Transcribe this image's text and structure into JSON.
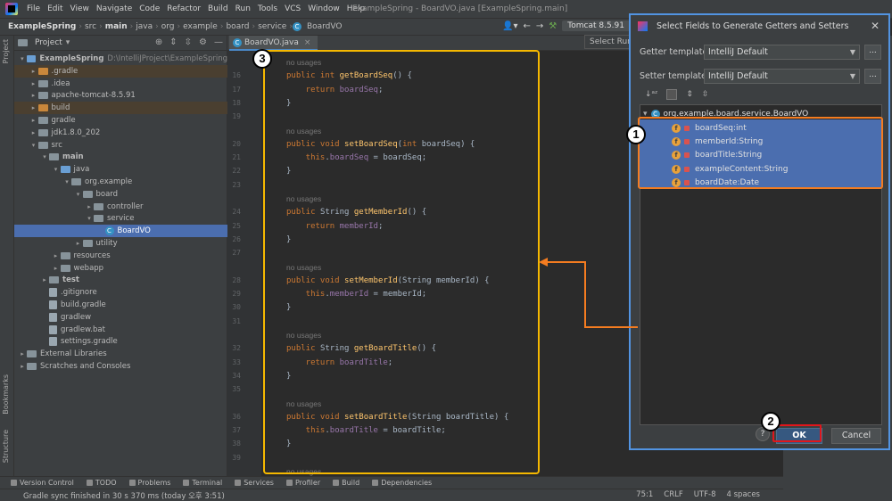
{
  "menu": [
    "File",
    "Edit",
    "View",
    "Navigate",
    "Code",
    "Refactor",
    "Build",
    "Run",
    "Tools",
    "VCS",
    "Window",
    "Help"
  ],
  "window_title": "ExampleSpring - BoardVO.java [ExampleSpring.main]",
  "breadcrumbs": [
    "ExampleSpring",
    "src",
    "main",
    "java",
    "org",
    "example",
    "board",
    "service",
    "BoardVO"
  ],
  "run_config": "Tomcat 8.5.91",
  "run_tooltip": "Select Run/",
  "left_tabs": [
    "Project",
    "Bookmarks",
    "Structure"
  ],
  "project_panel": {
    "title": "Project",
    "tree": [
      {
        "label": "ExampleSpring",
        "hint": "D:\\IntelliJProject\\ExampleSpring",
        "indent": 0,
        "open": true,
        "icon": "folder-blue",
        "bold": true
      },
      {
        "label": ".gradle",
        "indent": 1,
        "open": false,
        "icon": "folder-orange",
        "hl": true
      },
      {
        "label": ".idea",
        "indent": 1,
        "open": false,
        "icon": "folder"
      },
      {
        "label": "apache-tomcat-8.5.91",
        "indent": 1,
        "open": false,
        "icon": "folder"
      },
      {
        "label": "build",
        "indent": 1,
        "open": false,
        "icon": "folder-orange",
        "hl": true
      },
      {
        "label": "gradle",
        "indent": 1,
        "open": false,
        "icon": "folder"
      },
      {
        "label": "jdk1.8.0_202",
        "indent": 1,
        "open": false,
        "icon": "folder"
      },
      {
        "label": "src",
        "indent": 1,
        "open": true,
        "icon": "folder"
      },
      {
        "label": "main",
        "indent": 2,
        "open": true,
        "icon": "folder",
        "bold": true
      },
      {
        "label": "java",
        "indent": 3,
        "open": true,
        "icon": "folder-blue"
      },
      {
        "label": "org.example",
        "indent": 4,
        "open": true,
        "icon": "folder"
      },
      {
        "label": "board",
        "indent": 5,
        "open": true,
        "icon": "folder"
      },
      {
        "label": "controller",
        "indent": 6,
        "open": false,
        "icon": "folder"
      },
      {
        "label": "service",
        "indent": 6,
        "open": true,
        "icon": "folder"
      },
      {
        "label": "BoardVO",
        "indent": 7,
        "leaf": true,
        "icon": "class",
        "sel": true
      },
      {
        "label": "utility",
        "indent": 5,
        "open": false,
        "icon": "folder"
      },
      {
        "label": "resources",
        "indent": 3,
        "open": false,
        "icon": "folder"
      },
      {
        "label": "webapp",
        "indent": 3,
        "open": false,
        "icon": "folder"
      },
      {
        "label": "test",
        "indent": 2,
        "open": false,
        "icon": "folder",
        "bold": true
      },
      {
        "label": ".gitignore",
        "indent": 2,
        "leaf": true,
        "icon": "file"
      },
      {
        "label": "build.gradle",
        "indent": 2,
        "leaf": true,
        "icon": "file"
      },
      {
        "label": "gradlew",
        "indent": 2,
        "leaf": true,
        "icon": "file"
      },
      {
        "label": "gradlew.bat",
        "indent": 2,
        "leaf": true,
        "icon": "file"
      },
      {
        "label": "settings.gradle",
        "indent": 2,
        "leaf": true,
        "icon": "file"
      },
      {
        "label": "External Libraries",
        "indent": 0,
        "open": false,
        "icon": "folder"
      },
      {
        "label": "Scratches and Consoles",
        "indent": 0,
        "open": false,
        "icon": "folder"
      }
    ]
  },
  "editor": {
    "tab_label": "BoardVO.java",
    "lines": [
      {
        "n": "",
        "kind": "usages",
        "text": "no usages"
      },
      {
        "n": "16",
        "kind": "code",
        "parts": [
          [
            "kw",
            "public int "
          ],
          [
            "fn",
            "getBoardSeq"
          ],
          [
            "pl",
            "() {"
          ]
        ]
      },
      {
        "n": "17",
        "kind": "code",
        "parts": [
          [
            "kw",
            "    return "
          ],
          [
            "fld",
            "boardSeq"
          ],
          [
            "pl",
            ";"
          ]
        ]
      },
      {
        "n": "18",
        "kind": "code",
        "parts": [
          [
            "pl",
            "}"
          ]
        ]
      },
      {
        "n": "19",
        "kind": "code",
        "parts": []
      },
      {
        "n": "",
        "kind": "usages",
        "text": "no usages"
      },
      {
        "n": "20",
        "kind": "code",
        "parts": [
          [
            "kw",
            "public void "
          ],
          [
            "fn",
            "setBoardSeq"
          ],
          [
            "pl",
            "("
          ],
          [
            "kw",
            "int "
          ],
          [
            "pl",
            "boardSeq) {"
          ]
        ]
      },
      {
        "n": "21",
        "kind": "code",
        "parts": [
          [
            "kw",
            "    this"
          ],
          [
            "pl",
            "."
          ],
          [
            "fld",
            "boardSeq"
          ],
          [
            "pl",
            " = boardSeq;"
          ]
        ]
      },
      {
        "n": "22",
        "kind": "code",
        "parts": [
          [
            "pl",
            "}"
          ]
        ]
      },
      {
        "n": "23",
        "kind": "code",
        "parts": []
      },
      {
        "n": "",
        "kind": "usages",
        "text": "no usages"
      },
      {
        "n": "24",
        "kind": "code",
        "parts": [
          [
            "kw",
            "public "
          ],
          [
            "pl",
            "String "
          ],
          [
            "fn",
            "getMemberId"
          ],
          [
            "pl",
            "() {"
          ]
        ]
      },
      {
        "n": "25",
        "kind": "code",
        "parts": [
          [
            "kw",
            "    return "
          ],
          [
            "fld",
            "memberId"
          ],
          [
            "pl",
            ";"
          ]
        ]
      },
      {
        "n": "26",
        "kind": "code",
        "parts": [
          [
            "pl",
            "}"
          ]
        ]
      },
      {
        "n": "27",
        "kind": "code",
        "parts": []
      },
      {
        "n": "",
        "kind": "usages",
        "text": "no usages"
      },
      {
        "n": "28",
        "kind": "code",
        "parts": [
          [
            "kw",
            "public void "
          ],
          [
            "fn",
            "setMemberId"
          ],
          [
            "pl",
            "(String memberId) {"
          ]
        ]
      },
      {
        "n": "29",
        "kind": "code",
        "parts": [
          [
            "kw",
            "    this"
          ],
          [
            "pl",
            "."
          ],
          [
            "fld",
            "memberId"
          ],
          [
            "pl",
            " = memberId;"
          ]
        ]
      },
      {
        "n": "30",
        "kind": "code",
        "parts": [
          [
            "pl",
            "}"
          ]
        ]
      },
      {
        "n": "31",
        "kind": "code",
        "parts": []
      },
      {
        "n": "",
        "kind": "usages",
        "text": "no usages"
      },
      {
        "n": "32",
        "kind": "code",
        "parts": [
          [
            "kw",
            "public "
          ],
          [
            "pl",
            "String "
          ],
          [
            "fn",
            "getBoardTitle"
          ],
          [
            "pl",
            "() {"
          ]
        ]
      },
      {
        "n": "33",
        "kind": "code",
        "parts": [
          [
            "kw",
            "    return "
          ],
          [
            "fld",
            "boardTitle"
          ],
          [
            "pl",
            ";"
          ]
        ]
      },
      {
        "n": "34",
        "kind": "code",
        "parts": [
          [
            "pl",
            "}"
          ]
        ]
      },
      {
        "n": "35",
        "kind": "code",
        "parts": []
      },
      {
        "n": "",
        "kind": "usages",
        "text": "no usages"
      },
      {
        "n": "36",
        "kind": "code",
        "parts": [
          [
            "kw",
            "public void "
          ],
          [
            "fn",
            "setBoardTitle"
          ],
          [
            "pl",
            "(String boardTitle) {"
          ]
        ]
      },
      {
        "n": "37",
        "kind": "code",
        "parts": [
          [
            "kw",
            "    this"
          ],
          [
            "pl",
            "."
          ],
          [
            "fld",
            "boardTitle"
          ],
          [
            "pl",
            " = boardTitle;"
          ]
        ]
      },
      {
        "n": "38",
        "kind": "code",
        "parts": [
          [
            "pl",
            "}"
          ]
        ]
      },
      {
        "n": "39",
        "kind": "code",
        "parts": []
      },
      {
        "n": "",
        "kind": "usages",
        "text": "no usages"
      }
    ]
  },
  "dialog": {
    "title": "Select Fields to Generate Getters and Setters",
    "getter_label": "Getter template:",
    "getter_value": "IntelliJ Default",
    "setter_label": "Setter template:",
    "setter_value": "IntelliJ Default",
    "dots": "...",
    "class_node": "org.example.board.service.BoardVO",
    "fields": [
      "boardSeq:int",
      "memberId:String",
      "boardTitle:String",
      "exampleContent:String",
      "boardDate:Date"
    ],
    "ok": "OK",
    "cancel": "Cancel",
    "help": "?"
  },
  "badges": [
    "1",
    "2",
    "3"
  ],
  "tool_windows": [
    "Version Control",
    "TODO",
    "Problems",
    "Terminal",
    "Services",
    "Profiler",
    "Build",
    "Dependencies"
  ],
  "status": {
    "message": "Gradle sync finished in 30 s 370 ms (today 오후 3:51)",
    "position": "75:1",
    "line_sep": "CRLF",
    "encoding": "UTF-8",
    "indent": "4 spaces"
  },
  "colors": {
    "annotation_orange": "#f47c20",
    "annotation_yellow": "#f5b800",
    "annotation_red": "#e0161b",
    "accent": "#4b6eaf"
  }
}
